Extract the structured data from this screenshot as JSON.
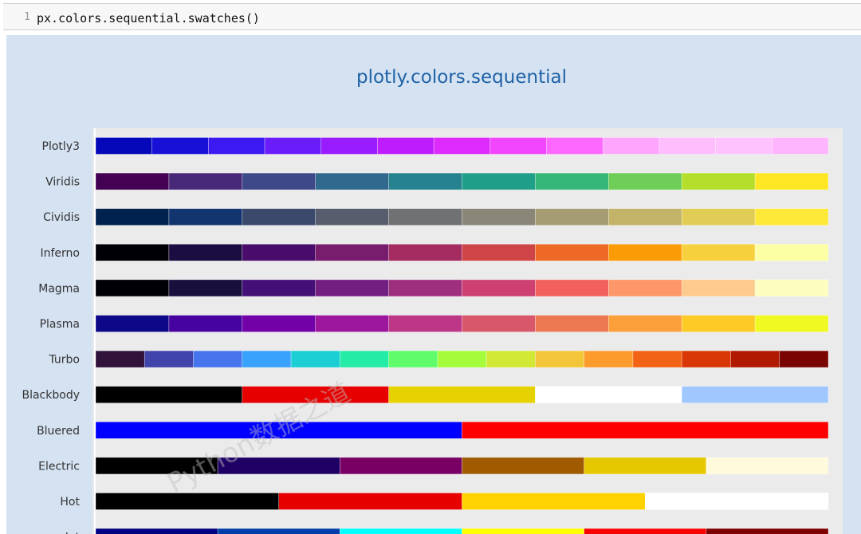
{
  "code_cell": {
    "line_number": "1",
    "code": "px.colors.sequential.swatches()"
  },
  "watermark": "Python数据之道",
  "colors": {
    "plot_bg": "#ebebeb",
    "output_bg": "#d5e2f2",
    "title_color": "#1e62a6"
  },
  "chart_data": {
    "type": "swatches",
    "title": "plotly.colors.sequential",
    "grid": false,
    "legend": "none",
    "rows": [
      {
        "name": "Plotly3",
        "colors": [
          "#0508b8",
          "#1910d8",
          "#3c19f0",
          "#6b1cfb",
          "#981cfd",
          "#bf1cfd",
          "#dd2bfd",
          "#f246fe",
          "#fc67fd",
          "#fea5fd",
          "#febefe",
          "#fec3fe",
          "#feb5fe"
        ]
      },
      {
        "name": "Viridis",
        "colors": [
          "#440154",
          "#482878",
          "#3e4989",
          "#31688e",
          "#26828e",
          "#1f9e89",
          "#35b779",
          "#6ece58",
          "#b5de2b",
          "#fde725"
        ]
      },
      {
        "name": "Cividis",
        "colors": [
          "#00224e",
          "#123570",
          "#3b496c",
          "#575d6d",
          "#707173",
          "#8a8678",
          "#a59c74",
          "#c3b369",
          "#e1cc55",
          "#fee838"
        ]
      },
      {
        "name": "Inferno",
        "colors": [
          "#000004",
          "#1b0c41",
          "#4a0c6b",
          "#781c6d",
          "#a52c60",
          "#cf4446",
          "#ed6925",
          "#fb9b06",
          "#f7d13d",
          "#fcffa4"
        ]
      },
      {
        "name": "Magma",
        "colors": [
          "#000004",
          "#180f3d",
          "#440f76",
          "#721f81",
          "#9e2f7f",
          "#cd4071",
          "#f1605d",
          "#fd9668",
          "#feca8d",
          "#fcfdbf"
        ]
      },
      {
        "name": "Plasma",
        "colors": [
          "#0d0887",
          "#46039f",
          "#7201a8",
          "#9c179e",
          "#bd3786",
          "#d8576b",
          "#ed7953",
          "#fb9f3a",
          "#fdca26",
          "#f0f921"
        ]
      },
      {
        "name": "Turbo",
        "colors": [
          "#30123b",
          "#4145ab",
          "#4675ed",
          "#39a2fc",
          "#1bcfd4",
          "#24eca6",
          "#61fc6c",
          "#a4fc3b",
          "#d1e834",
          "#f3c63a",
          "#fe9b2d",
          "#f36315",
          "#d93806",
          "#b11901",
          "#7a0402"
        ]
      },
      {
        "name": "Blackbody",
        "colors": [
          "#000000",
          "#e60000",
          "#e6d200",
          "#ffffff",
          "#a0c8ff"
        ]
      },
      {
        "name": "Bluered",
        "colors": [
          "#0000ff",
          "#ff0000"
        ]
      },
      {
        "name": "Electric",
        "colors": [
          "#000000",
          "#1e0064",
          "#780064",
          "#a05a00",
          "#e6c800",
          "#fffadc"
        ]
      },
      {
        "name": "Hot",
        "colors": [
          "#000000",
          "#e60000",
          "#ffd200",
          "#ffffff"
        ]
      },
      {
        "name": "Jet",
        "colors": [
          "#000083",
          "#003caa",
          "#05ffff",
          "#ffff00",
          "#fa0000",
          "#800000"
        ]
      }
    ]
  }
}
